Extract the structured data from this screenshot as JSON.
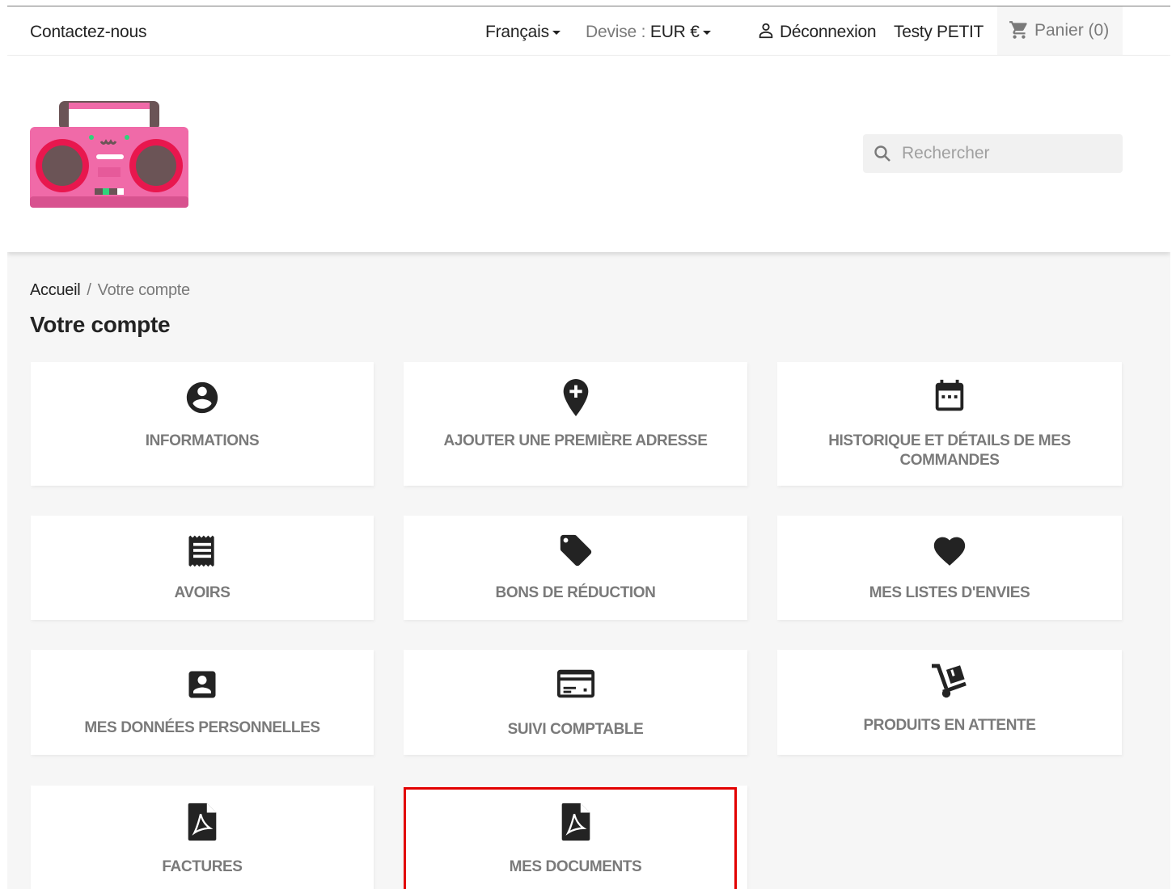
{
  "topnav": {
    "contact": "Contactez-nous",
    "language": "Français",
    "currency_label": "Devise :",
    "currency_value": "EUR €",
    "logout": "Déconnexion",
    "username": "Testy PETIT",
    "cart": "Panier (0)"
  },
  "search": {
    "placeholder": "Rechercher"
  },
  "breadcrumb": {
    "home": "Accueil",
    "separator": "/",
    "current": "Votre compte"
  },
  "page_title": "Votre compte",
  "tiles": [
    {
      "label": "INFORMATIONS",
      "icon": "account-circle-icon"
    },
    {
      "label": "AJOUTER UNE PREMIÈRE ADRESSE",
      "icon": "add-location-icon"
    },
    {
      "label": "HISTORIQUE ET DÉTAILS DE MES COMMANDES",
      "icon": "calendar-icon"
    },
    {
      "label": "AVOIRS",
      "icon": "receipt-icon"
    },
    {
      "label": "BONS DE RÉDUCTION",
      "icon": "tag-icon"
    },
    {
      "label": "MES LISTES D'ENVIES",
      "icon": "heart-icon"
    },
    {
      "label": "MES DONNÉES PERSONNELLES",
      "icon": "account-box-icon"
    },
    {
      "label": "SUIVI COMPTABLE",
      "icon": "credit-card-icon"
    },
    {
      "label": "PRODUITS EN ATTENTE",
      "icon": "dolly-icon"
    },
    {
      "label": "FACTURES",
      "icon": "pdf-icon"
    },
    {
      "label": "MES DOCUMENTS",
      "icon": "pdf-icon"
    }
  ],
  "colors": {
    "highlight": "#e20000",
    "tile_text": "#7a7a7a",
    "logo_pink": "#f06aa8"
  }
}
